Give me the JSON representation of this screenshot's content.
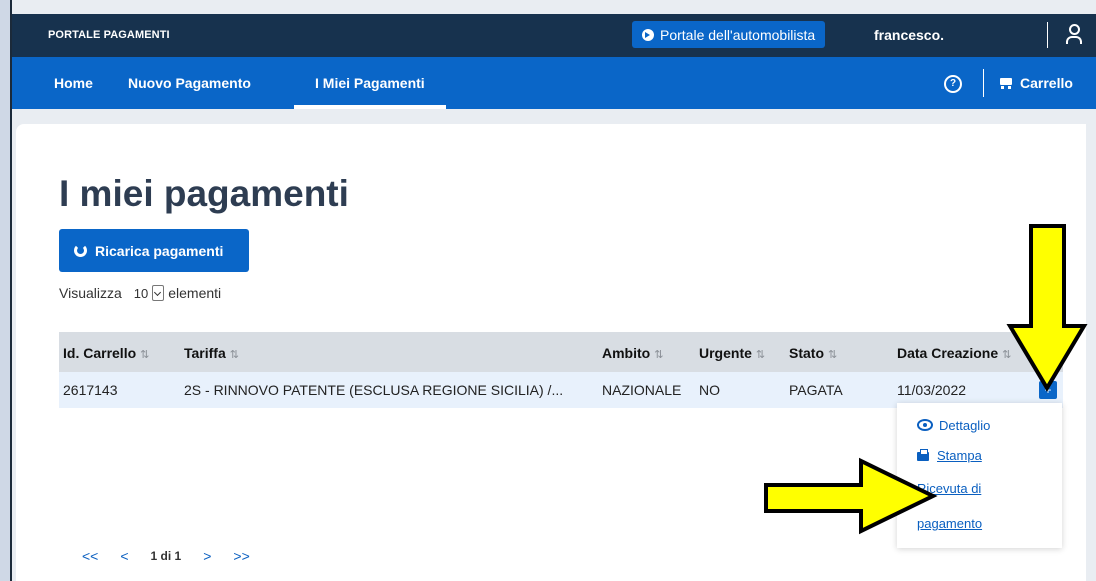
{
  "header": {
    "brand": "PORTALE PAGAMENTI",
    "portal_button": "Portale dell'automobilista",
    "user": "francesco."
  },
  "nav": {
    "items": [
      "Home",
      "Nuovo Pagamento",
      "I Miei Pagamenti"
    ],
    "active": "I Miei Pagamenti",
    "cart_label": "Carrello"
  },
  "page": {
    "title": "I miei pagamenti",
    "reload_button": "Ricarica pagamenti",
    "show_prefix": "Visualizza",
    "show_value": "10",
    "show_suffix": "elementi"
  },
  "table": {
    "columns": [
      "Id. Carrello",
      "Tariffa",
      "Ambito",
      "Urgente",
      "Stato",
      "Data Creazione"
    ],
    "rows": [
      {
        "id": "2617143",
        "tariffa": "2S - RINNOVO PATENTE (ESCLUSA REGIONE SICILIA) /...",
        "ambito": "NAZIONALE",
        "urgente": "NO",
        "stato": "PAGATA",
        "data": "11/03/2022",
        "action": "+"
      }
    ]
  },
  "row_menu": {
    "detail": "Dettaglio",
    "print": "Stampa",
    "receipt_line1": "Ricevuta di",
    "receipt_line2": "pagamento"
  },
  "pagination": {
    "first": "<<",
    "prev": "<",
    "current": "1 di 1",
    "next": ">",
    "last": ">>"
  },
  "annotations": {
    "arrow_color": "#ffff00",
    "arrow_stroke": "#000000"
  }
}
